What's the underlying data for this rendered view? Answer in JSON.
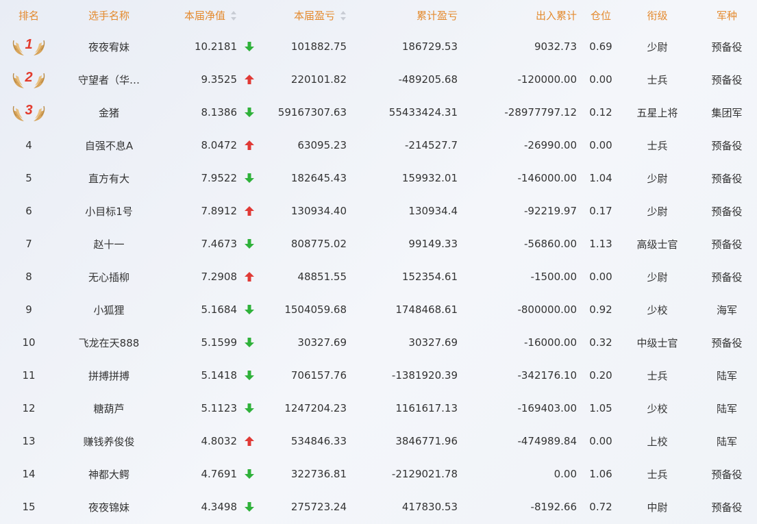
{
  "colors": {
    "header_text": "#e48a2e",
    "up": "#e03a36",
    "down": "#2fb13a",
    "medal_wing": "#d7a45b",
    "medal_number": "#e23b2e"
  },
  "headers": {
    "rank": "排名",
    "name": "选手名称",
    "nav": "本届净值",
    "current_pl": "本届盈亏",
    "cumulative_pl": "累计盈亏",
    "in_out": "出入累计",
    "position": "仓位",
    "rank_title": "衔级",
    "branch": "军种"
  },
  "rows": [
    {
      "rank": "1",
      "medal": true,
      "name": "夜夜宥妹",
      "nav": "10.2181",
      "trend": "down",
      "current_pl": "101882.75",
      "cumulative_pl": "186729.53",
      "in_out": "9032.73",
      "position": "0.69",
      "rank_title": "少尉",
      "branch": "预备役"
    },
    {
      "rank": "2",
      "medal": true,
      "name": "守望者（华…",
      "nav": "9.3525",
      "trend": "up",
      "current_pl": "220101.82",
      "cumulative_pl": "-489205.68",
      "in_out": "-120000.00",
      "position": "0.00",
      "rank_title": "士兵",
      "branch": "预备役"
    },
    {
      "rank": "3",
      "medal": true,
      "name": "金猪",
      "nav": "8.1386",
      "trend": "down",
      "current_pl": "59167307.63",
      "cumulative_pl": "55433424.31",
      "in_out": "-28977797.12",
      "position": "0.12",
      "rank_title": "五星上将",
      "branch": "集团军"
    },
    {
      "rank": "4",
      "medal": false,
      "name": "自强不息A",
      "nav": "8.0472",
      "trend": "up",
      "current_pl": "63095.23",
      "cumulative_pl": "-214527.7",
      "in_out": "-26990.00",
      "position": "0.00",
      "rank_title": "士兵",
      "branch": "预备役"
    },
    {
      "rank": "5",
      "medal": false,
      "name": "直方有大",
      "nav": "7.9522",
      "trend": "down",
      "current_pl": "182645.43",
      "cumulative_pl": "159932.01",
      "in_out": "-146000.00",
      "position": "1.04",
      "rank_title": "少尉",
      "branch": "预备役"
    },
    {
      "rank": "6",
      "medal": false,
      "name": "小目标1号",
      "nav": "7.8912",
      "trend": "up",
      "current_pl": "130934.40",
      "cumulative_pl": "130934.4",
      "in_out": "-92219.97",
      "position": "0.17",
      "rank_title": "少尉",
      "branch": "预备役"
    },
    {
      "rank": "7",
      "medal": false,
      "name": "赵十一",
      "nav": "7.4673",
      "trend": "down",
      "current_pl": "808775.02",
      "cumulative_pl": "99149.33",
      "in_out": "-56860.00",
      "position": "1.13",
      "rank_title": "高级士官",
      "branch": "预备役"
    },
    {
      "rank": "8",
      "medal": false,
      "name": "无心插柳",
      "nav": "7.2908",
      "trend": "up",
      "current_pl": "48851.55",
      "cumulative_pl": "152354.61",
      "in_out": "-1500.00",
      "position": "0.00",
      "rank_title": "少尉",
      "branch": "预备役"
    },
    {
      "rank": "9",
      "medal": false,
      "name": "小狐狸",
      "nav": "5.1684",
      "trend": "down",
      "current_pl": "1504059.68",
      "cumulative_pl": "1748468.61",
      "in_out": "-800000.00",
      "position": "0.92",
      "rank_title": "少校",
      "branch": "海军"
    },
    {
      "rank": "10",
      "medal": false,
      "name": "飞龙在天888",
      "nav": "5.1599",
      "trend": "down",
      "current_pl": "30327.69",
      "cumulative_pl": "30327.69",
      "in_out": "-16000.00",
      "position": "0.32",
      "rank_title": "中级士官",
      "branch": "预备役"
    },
    {
      "rank": "11",
      "medal": false,
      "name": "拼搏拼搏",
      "nav": "5.1418",
      "trend": "down",
      "current_pl": "706157.76",
      "cumulative_pl": "-1381920.39",
      "in_out": "-342176.10",
      "position": "0.20",
      "rank_title": "士兵",
      "branch": "陆军"
    },
    {
      "rank": "12",
      "medal": false,
      "name": "糖葫芦",
      "nav": "5.1123",
      "trend": "down",
      "current_pl": "1247204.23",
      "cumulative_pl": "1161617.13",
      "in_out": "-169403.00",
      "position": "1.05",
      "rank_title": "少校",
      "branch": "陆军"
    },
    {
      "rank": "13",
      "medal": false,
      "name": "赚钱养俊俊",
      "nav": "4.8032",
      "trend": "up",
      "current_pl": "534846.33",
      "cumulative_pl": "3846771.96",
      "in_out": "-474989.84",
      "position": "0.00",
      "rank_title": "上校",
      "branch": "陆军"
    },
    {
      "rank": "14",
      "medal": false,
      "name": "神都大鳄",
      "nav": "4.7691",
      "trend": "down",
      "current_pl": "322736.81",
      "cumulative_pl": "-2129021.78",
      "in_out": "0.00",
      "position": "1.06",
      "rank_title": "士兵",
      "branch": "预备役"
    },
    {
      "rank": "15",
      "medal": false,
      "name": "夜夜锦妹",
      "nav": "4.3498",
      "trend": "down",
      "current_pl": "275723.24",
      "cumulative_pl": "417830.53",
      "in_out": "-8192.66",
      "position": "0.72",
      "rank_title": "中尉",
      "branch": "预备役"
    }
  ]
}
